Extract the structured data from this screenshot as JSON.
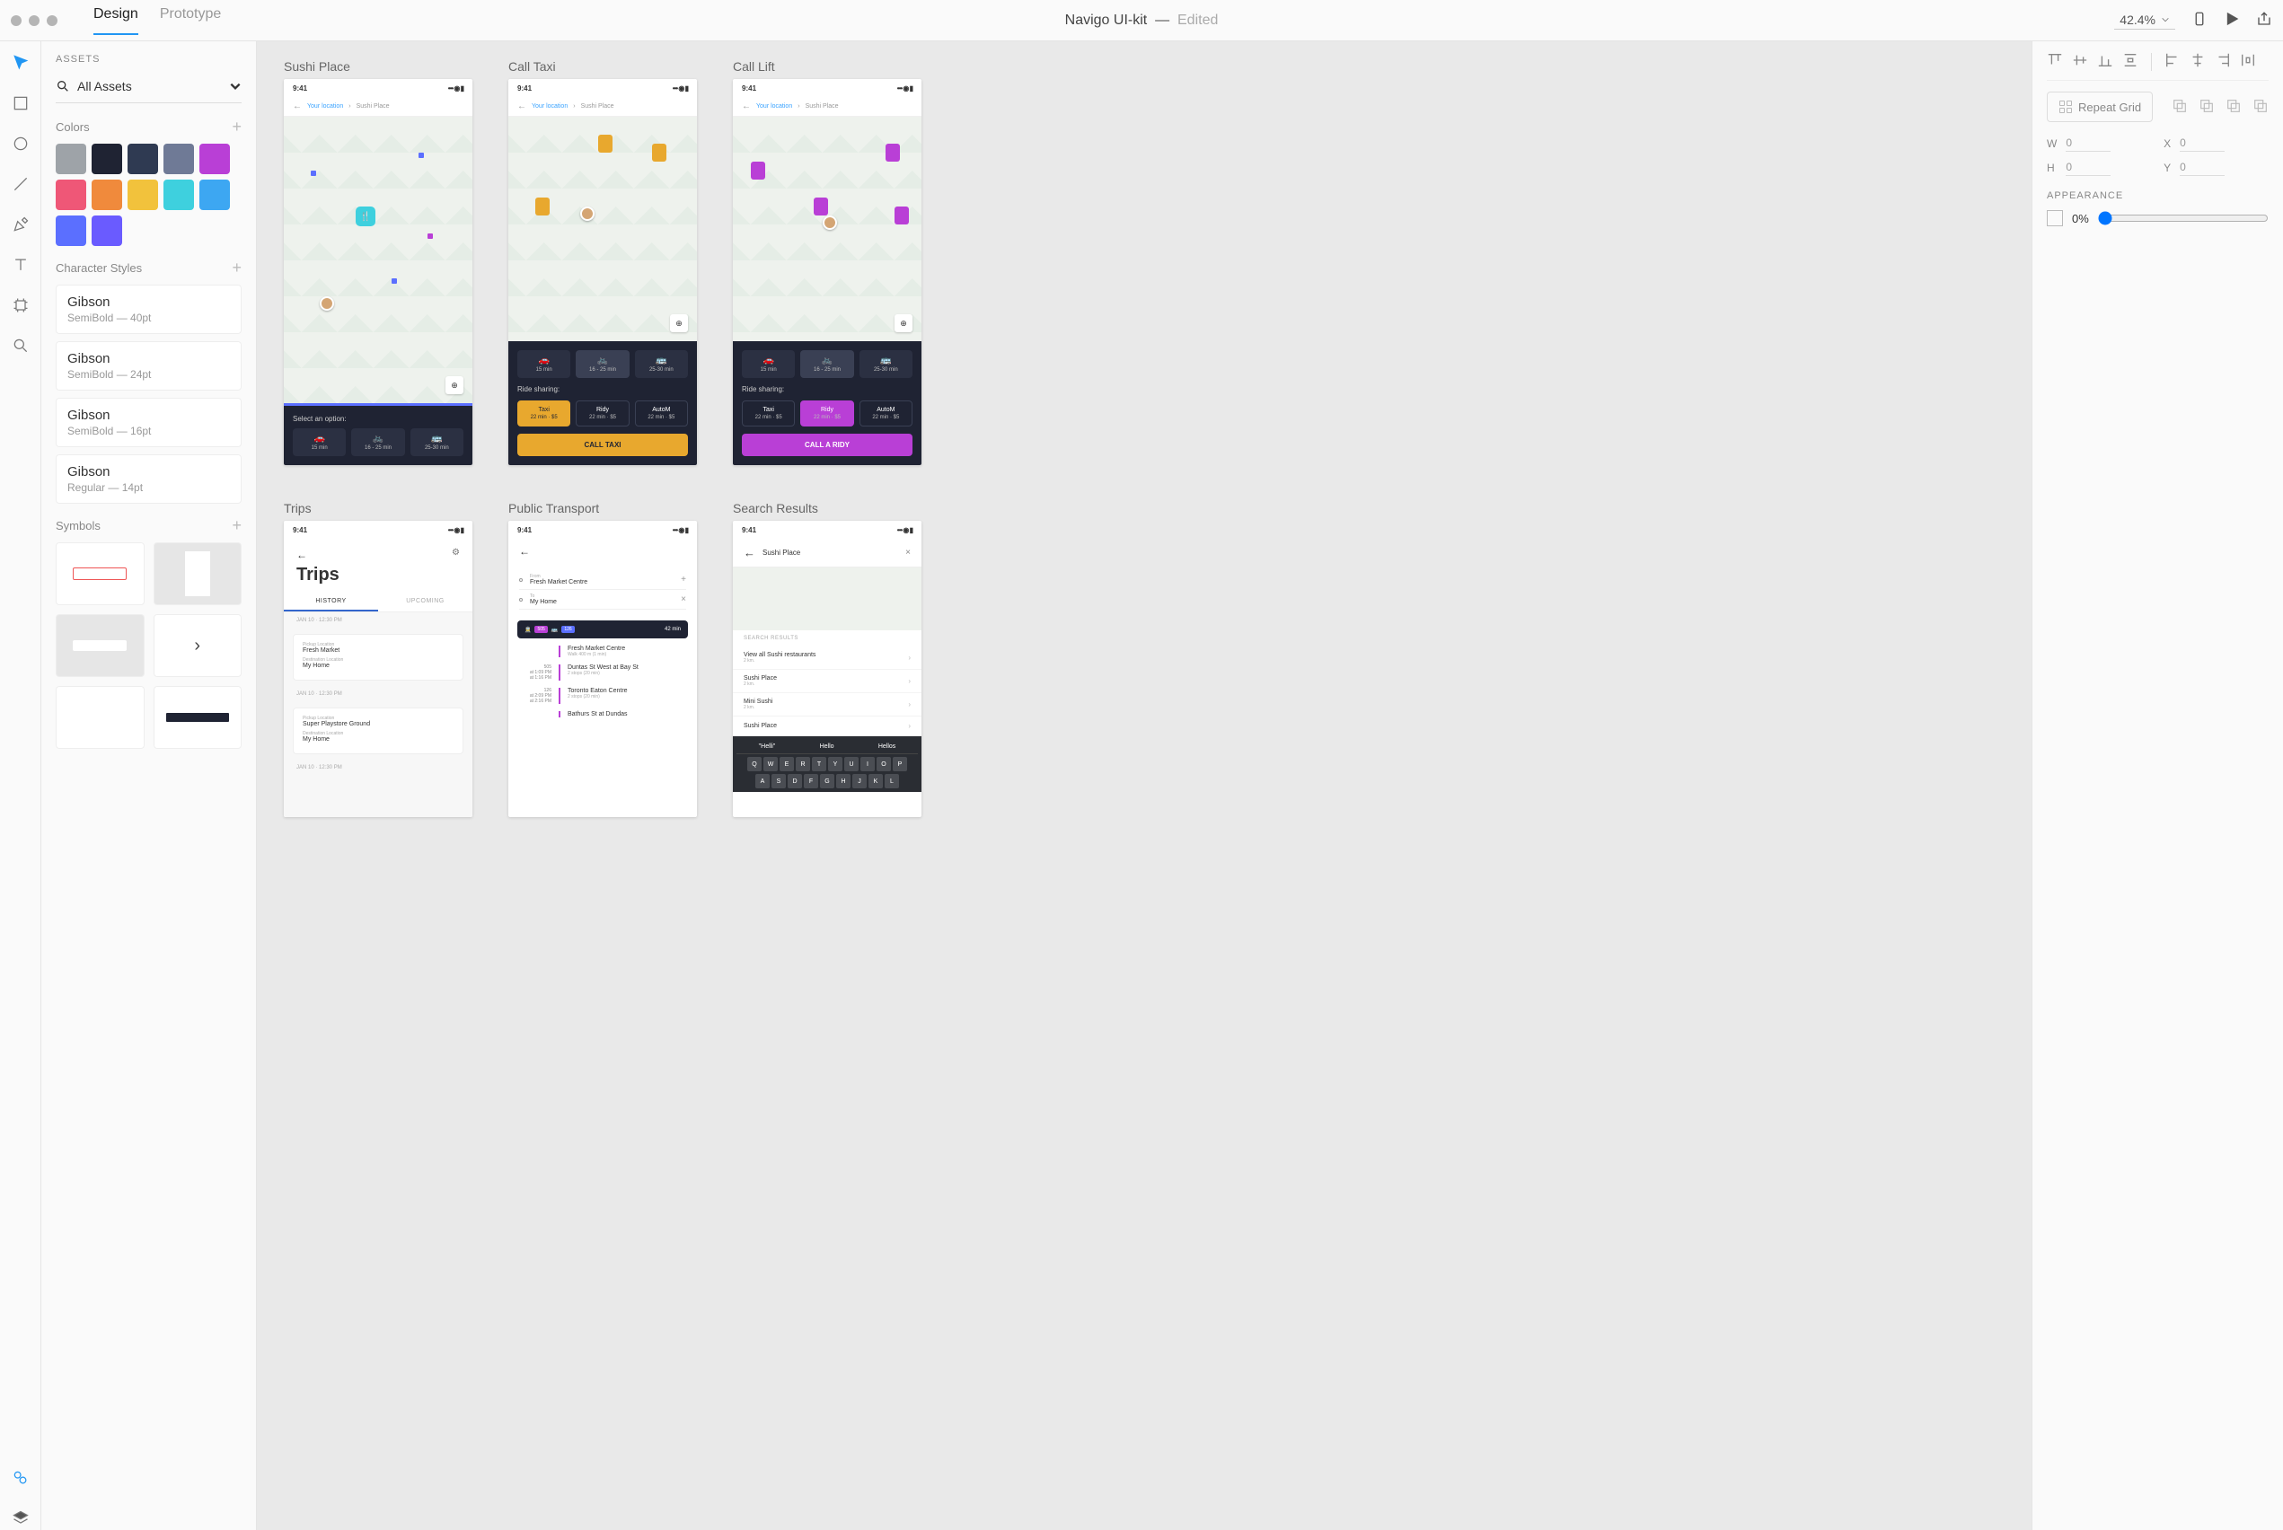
{
  "titlebar": {
    "tabs": [
      "Design",
      "Prototype"
    ],
    "active": 0,
    "doc": "Navigo UI-kit",
    "status": "Edited",
    "zoom": "42.4%"
  },
  "tools": [
    "select",
    "rect",
    "ellipse",
    "line",
    "pen",
    "text",
    "artboard",
    "zoom"
  ],
  "assets": {
    "header": "ASSETS",
    "picker": "All Assets",
    "colors_h": "Colors",
    "colors": [
      "#9ea3a8",
      "#1f2333",
      "#2f3a52",
      "#6f7a96",
      "#b93fd6",
      "#ef5777",
      "#f08a3c",
      "#f2c23c",
      "#3ed0de",
      "#3da7f2",
      "#5b6fff",
      "#6a5bff"
    ],
    "char_h": "Character Styles",
    "chars": [
      {
        "name": "Gibson",
        "meta": "SemiBold — 40pt"
      },
      {
        "name": "Gibson",
        "meta": "SemiBold — 24pt"
      },
      {
        "name": "Gibson",
        "meta": "SemiBold — 16pt"
      },
      {
        "name": "Gibson",
        "meta": "Regular — 14pt"
      }
    ],
    "sym_h": "Symbols"
  },
  "artboards": {
    "sushi": {
      "label": "Sushi Place",
      "time": "9:41",
      "yl": "Your location",
      "dest": "Sushi Place",
      "prompt": "Select an option:",
      "opts": [
        {
          "i": "🚗",
          "t": "15 min"
        },
        {
          "i": "🚲",
          "t": "16 - 25 min"
        },
        {
          "i": "🚌",
          "t": "25-30 min"
        }
      ]
    },
    "taxi": {
      "label": "Call Taxi",
      "time": "9:41",
      "yl": "Your location",
      "dest": "Sushi Place",
      "rs": "Ride sharing:",
      "opts": [
        {
          "i": "🚗",
          "t": "15 min"
        },
        {
          "i": "🚲",
          "t": "16 - 25 min"
        },
        {
          "i": "🚌",
          "t": "25-30 min"
        }
      ],
      "rides": [
        {
          "n": "Taxi",
          "m": "22 min · $5"
        },
        {
          "n": "Ridy",
          "m": "22 min · $5"
        },
        {
          "n": "AutoM",
          "m": "22 min · $5"
        }
      ],
      "cta": "CALL TAXI"
    },
    "lift": {
      "label": "Call Lift",
      "time": "9:41",
      "yl": "Your location",
      "dest": "Sushi Place",
      "rs": "Ride sharing:",
      "opts": [
        {
          "i": "🚗",
          "t": "15 min"
        },
        {
          "i": "🚲",
          "t": "16 - 25 min"
        },
        {
          "i": "🚌",
          "t": "25-30 min"
        }
      ],
      "rides": [
        {
          "n": "Taxi",
          "m": "22 min · $5"
        },
        {
          "n": "Ridy",
          "m": "22 min · $5"
        },
        {
          "n": "AutoM",
          "m": "22 min · $5"
        }
      ],
      "cta": "CALL A RIDY"
    },
    "trips": {
      "label": "Trips",
      "time": "9:41",
      "title": "Trips",
      "tabs": [
        "HISTORY",
        "UPCOMING"
      ],
      "groups": [
        {
          "date": "JAN 10 · 12:30 PM",
          "pl": "Pickup Location",
          "pv": "Fresh Market",
          "dl": "Destination Location",
          "dv": "My Home"
        },
        {
          "date": "JAN 10 · 12:30 PM",
          "pl": "Pickup Location",
          "pv": "Super Playstore Ground",
          "dl": "Destination Location",
          "dv": "My Home"
        },
        {
          "date": "JAN 10 · 12:30 PM"
        }
      ]
    },
    "pt": {
      "label": "Public Transport",
      "time": "9:41",
      "from_l": "From",
      "from": "Fresh Market Centre",
      "to_l": "To",
      "to": "My Home",
      "banner": {
        "b1": "505",
        "b2": "126",
        "time": "42 min"
      },
      "steps": [
        {
          "left": "",
          "station": "Fresh Market Centre",
          "sub": "Walk 400 m (1 min)"
        },
        {
          "left": "505\nat 1:09 PM\nat 1:16 PM",
          "station": "Duntas St West at Bay St",
          "sub": "2 stops  (20 min)"
        },
        {
          "left": "126\nat 2:09 PM\nat 2:16 PM",
          "station": "Toronto Eaton Centre",
          "sub": "2 stops  (20 min)"
        },
        {
          "left": "",
          "station": "Bathurs St at Dundas",
          "sub": ""
        }
      ]
    },
    "sr": {
      "label": "Search Results",
      "time": "9:41",
      "query": "Sushi Place",
      "header": "SEARCH RESULTS",
      "items": [
        {
          "t": "View all Sushi restaurants",
          "d": "2 km."
        },
        {
          "t": "Sushi Place",
          "d": "2 km."
        },
        {
          "t": "Mini Sushi",
          "d": "2 km."
        },
        {
          "t": "Sushi Place",
          "d": ""
        }
      ],
      "kbd": {
        "sugg": [
          "\"Helli\"",
          "Hello",
          "Hellos"
        ],
        "rows": [
          [
            "Q",
            "W",
            "E",
            "R",
            "T",
            "Y",
            "U",
            "I",
            "O",
            "P"
          ],
          [
            "A",
            "S",
            "D",
            "F",
            "G",
            "H",
            "J",
            "K",
            "L"
          ]
        ]
      }
    }
  },
  "inspector": {
    "repeat": "Repeat Grid",
    "w_l": "W",
    "w": "0",
    "x_l": "X",
    "x": "0",
    "h_l": "H",
    "h": "0",
    "y_l": "Y",
    "y": "0",
    "app_h": "APPEARANCE",
    "opacity": "0%"
  }
}
